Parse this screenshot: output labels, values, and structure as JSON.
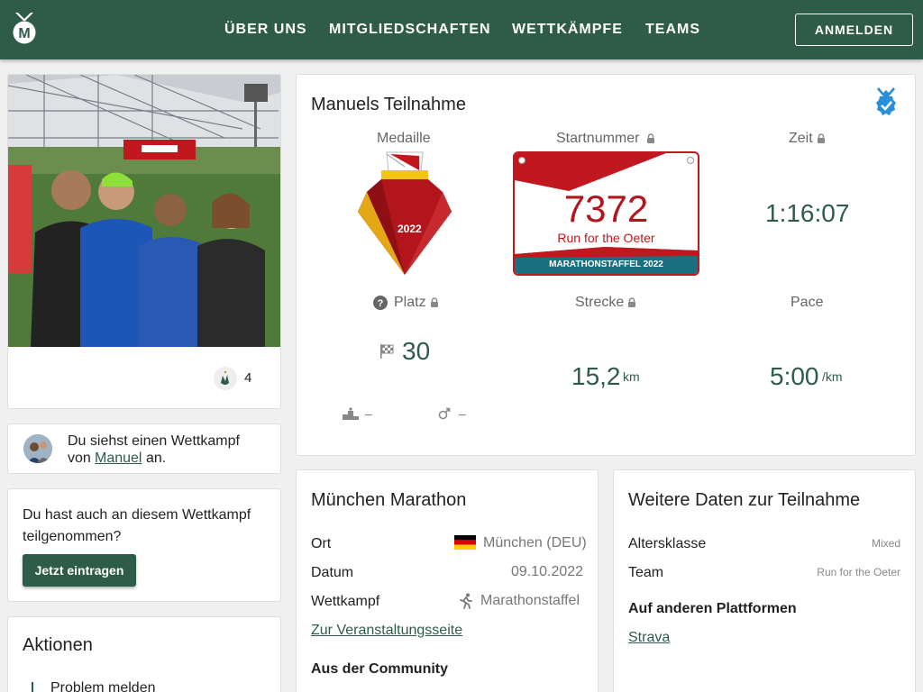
{
  "header": {
    "nav": [
      "ÜBER UNS",
      "MITGLIEDSCHAFTEN",
      "WETTKÄMPFE",
      "TEAMS"
    ],
    "login_label": "ANMELDEN",
    "logo_letter": "M"
  },
  "photo_card": {
    "like_count": "4"
  },
  "viewer_card": {
    "text_prefix": "Du siehst einen Wettkampf",
    "text_von": "von",
    "user_link": "Manuel",
    "text_suffix": "an."
  },
  "participate_card": {
    "line1": "Du hast auch an diesem Wettkampf",
    "line2": "teilgenommen?",
    "button_label": "Jetzt eintragen"
  },
  "actions_card": {
    "title": "Aktionen",
    "item1": "Problem melden"
  },
  "participation": {
    "title": "Manuels Teilnahme",
    "medal_label": "Medaille",
    "medal_year": "2022",
    "bib_label": "Startnummer",
    "bib_number": "7372",
    "bib_team": "Run for the Oeter",
    "bib_footer": "MARATHONSTAFFEL 2022",
    "time_label": "Zeit",
    "time_value": "1:16:07",
    "place_label": "Platz",
    "place_value": "30",
    "distance_label": "Strecke",
    "distance_value": "15,2",
    "distance_unit": "km",
    "pace_label": "Pace",
    "pace_value": "5:00",
    "pace_unit": "/km",
    "ak_rank": "–",
    "gender_rank": "–",
    "question_mark": "?"
  },
  "event": {
    "title": "München Marathon",
    "rows": [
      {
        "label": "Ort",
        "value": "München (DEU)"
      },
      {
        "label": "Datum",
        "value": "09.10.2022"
      },
      {
        "label": "Wettkampf",
        "value": "Marathonstaffel"
      }
    ],
    "link": "Zur Veranstaltungsseite",
    "community_title": "Aus der Community"
  },
  "more_data": {
    "title": "Weitere Daten zur Teilnahme",
    "rows": [
      {
        "label": "Altersklasse",
        "value": "Mixed"
      },
      {
        "label": "Team",
        "value": "Run for the Oeter"
      }
    ],
    "platforms_title": "Auf anderen Plattformen",
    "platform_link": "Strava"
  },
  "colors": {
    "brand_green": "#2f5c49",
    "bib_red": "#c0181e",
    "bib_teal": "#1a7080",
    "medal_red": "#b3151c",
    "medal_gold": "#f3c316",
    "verified_blue": "#2a8fd8"
  },
  "icons": {
    "verified": "verified-badge-icon",
    "lock": "lock-icon",
    "flag": "checkered-flag-icon",
    "podium": "podium-icon",
    "gender": "male-icon",
    "runner": "runner-icon",
    "clap": "clapping-hands-icon"
  }
}
